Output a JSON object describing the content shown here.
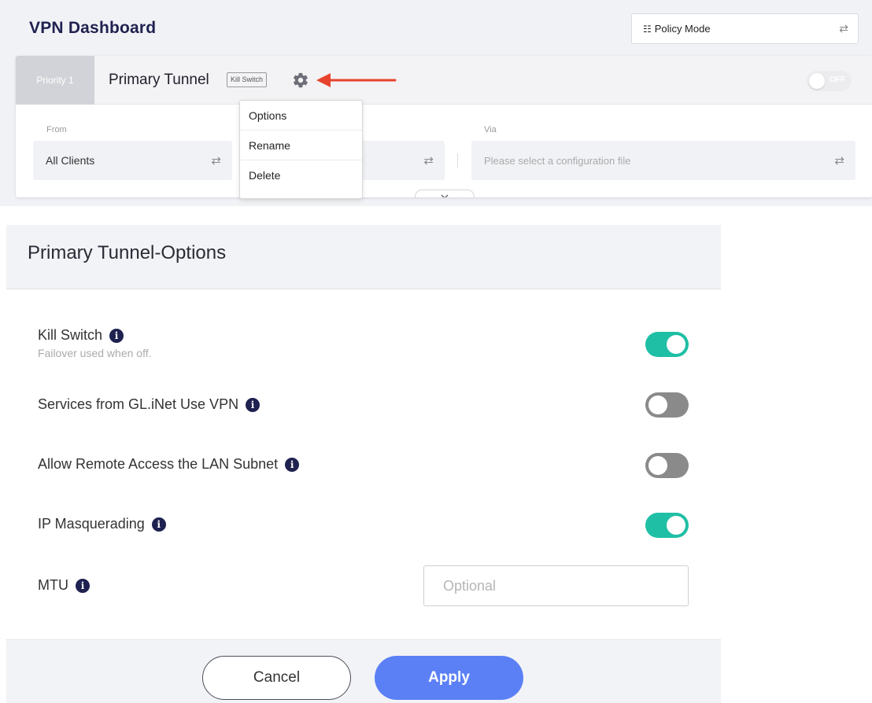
{
  "dashboard": {
    "title": "VPN Dashboard",
    "policy_mode": {
      "icon": "sitemap-icon",
      "value": "Policy Mode"
    },
    "tunnel": {
      "priority": "Priority 1",
      "name": "Primary Tunnel",
      "badge": "Kill Switch",
      "toggle": {
        "state": "off",
        "label": "OFF"
      },
      "from": {
        "label": "From",
        "value": "All Clients"
      },
      "via": {
        "label": "Via",
        "placeholder": "Please select a configuration file"
      }
    },
    "context_menu": [
      "Options",
      "Rename",
      "Delete"
    ],
    "arrow_color": "#e8432e"
  },
  "options": {
    "title": "Primary Tunnel-Options",
    "kill_switch": {
      "label": "Kill Switch",
      "subtitle": "Failover used when off.",
      "on": true
    },
    "services_vpn": {
      "label": "Services from GL.iNet Use VPN",
      "on": false
    },
    "remote_access": {
      "label": "Allow Remote Access the LAN Subnet",
      "on": false
    },
    "ip_masquerading": {
      "label": "IP Masquerading",
      "on": true
    },
    "mtu": {
      "label": "MTU",
      "placeholder": "Optional",
      "value": ""
    },
    "info_icon": "i",
    "cancel_label": "Cancel",
    "apply_label": "Apply",
    "colors": {
      "switch_on": "#1fbfa5",
      "switch_off": "#8a8a8a",
      "apply": "#5b80f5",
      "title": "#1f2150"
    }
  }
}
